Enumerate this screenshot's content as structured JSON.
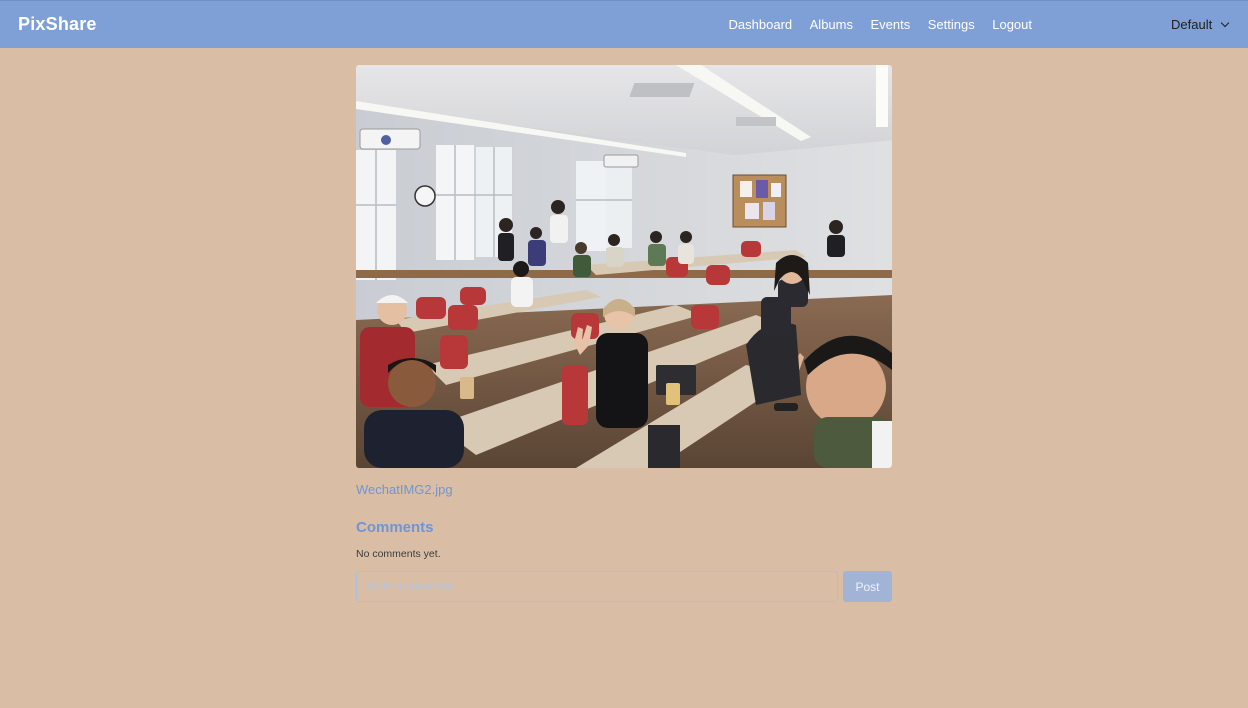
{
  "navbar": {
    "brand": "PixShare",
    "links": [
      "Dashboard",
      "Albums",
      "Events",
      "Settings",
      "Logout"
    ],
    "profile_selected": "Default"
  },
  "photo": {
    "filename": "WechatIMG2.jpg"
  },
  "comments": {
    "heading": "Comments",
    "empty_text": "No comments yet.",
    "input_placeholder": "Write a comment",
    "input_value": "",
    "post_label": "Post"
  },
  "colors": {
    "navbar_bg": "#7fa0d6",
    "page_bg": "#d9bea5",
    "link_accent": "#6e95d6",
    "post_button_bg": "#a2b4d6"
  },
  "icons": [
    "chevron-down-icon"
  ]
}
